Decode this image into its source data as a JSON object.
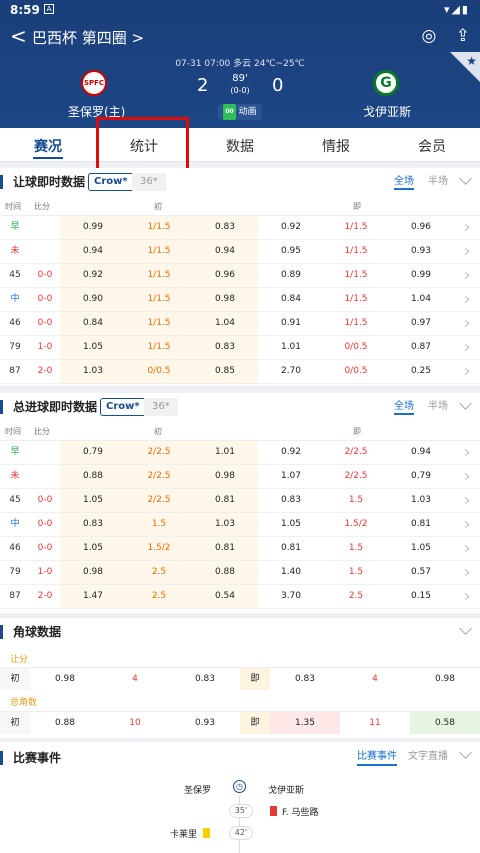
{
  "status": {
    "time": "8:59",
    "notif": "A",
    "icons": "▾◢▮"
  },
  "nav": {
    "back": "<",
    "league": "巴西杯 第四圈 >",
    "icons": [
      "◎",
      "⇪"
    ]
  },
  "match": {
    "info": "07-31 07:00  多云 24℃~25℃",
    "home": {
      "name": "圣保罗(主)",
      "score": "2",
      "logo_text": "SPFC"
    },
    "away": {
      "name": "戈伊亚斯",
      "score": "0",
      "logo_text": "G"
    },
    "minute": "89'",
    "half": "(0-0)",
    "anim_badge": "00",
    "anim_label": "动画"
  },
  "tabs": [
    "赛况",
    "统计",
    "数据",
    "情报",
    "会员"
  ],
  "handicap": {
    "title": "让球即时数据",
    "company": "Crow*",
    "company2": "36*",
    "scope_on": "全场",
    "scope_off": "半场",
    "cols": {
      "time": "时间",
      "score": "比分",
      "init": "初",
      "live": "即"
    },
    "rows": [
      {
        "t": "早",
        "s": "",
        "a": "0.99",
        "b": "1/1.5",
        "c": "0.83",
        "d": "0.92",
        "e": "1/1.5",
        "f": "0.96"
      },
      {
        "t": "未",
        "s": "",
        "a": "0.94",
        "b": "1/1.5",
        "c": "0.94",
        "d": "0.95",
        "e": "1/1.5",
        "f": "0.93"
      },
      {
        "t": "45",
        "s": "0-0",
        "a": "0.92",
        "b": "1/1.5",
        "c": "0.96",
        "d": "0.89",
        "e": "1/1.5",
        "f": "0.99"
      },
      {
        "t": "中",
        "s": "0-0",
        "a": "0.90",
        "b": "1/1.5",
        "c": "0.98",
        "d": "0.84",
        "e": "1/1.5",
        "f": "1.04"
      },
      {
        "t": "46",
        "s": "0-0",
        "a": "0.84",
        "b": "1/1.5",
        "c": "1.04",
        "d": "0.91",
        "e": "1/1.5",
        "f": "0.97"
      },
      {
        "t": "79",
        "s": "1-0",
        "a": "1.05",
        "b": "1/1.5",
        "c": "0.83",
        "d": "1.01",
        "e": "0/0.5",
        "f": "0.87"
      },
      {
        "t": "87",
        "s": "2-0",
        "a": "1.03",
        "b": "0/0.5",
        "c": "0.85",
        "d": "2.70",
        "e": "0/0.5",
        "f": "0.25"
      }
    ]
  },
  "totals": {
    "title": "总进球即时数据",
    "company": "Crow*",
    "company2": "36*",
    "scope_on": "全场",
    "scope_off": "半场",
    "cols": {
      "time": "时间",
      "score": "比分",
      "init": "初",
      "live": "即"
    },
    "rows": [
      {
        "t": "早",
        "s": "",
        "a": "0.79",
        "b": "2/2.5",
        "c": "1.01",
        "d": "0.92",
        "e": "2/2.5",
        "f": "0.94"
      },
      {
        "t": "未",
        "s": "",
        "a": "0.88",
        "b": "2/2.5",
        "c": "0.98",
        "d": "1.07",
        "e": "2/2.5",
        "f": "0.79"
      },
      {
        "t": "45",
        "s": "0-0",
        "a": "1.05",
        "b": "2/2.5",
        "c": "0.81",
        "d": "0.83",
        "e": "1.5",
        "f": "1.03"
      },
      {
        "t": "中",
        "s": "0-0",
        "a": "0.83",
        "b": "1.5",
        "c": "1.03",
        "d": "1.05",
        "e": "1.5/2",
        "f": "0.81"
      },
      {
        "t": "46",
        "s": "0-0",
        "a": "1.05",
        "b": "1.5/2",
        "c": "0.81",
        "d": "0.81",
        "e": "1.5",
        "f": "1.05"
      },
      {
        "t": "79",
        "s": "1-0",
        "a": "0.98",
        "b": "2.5",
        "c": "0.88",
        "d": "1.40",
        "e": "1.5",
        "f": "0.57"
      },
      {
        "t": "87",
        "s": "2-0",
        "a": "1.47",
        "b": "2.5",
        "c": "0.54",
        "d": "3.70",
        "e": "2.5",
        "f": "0.15"
      }
    ]
  },
  "corners": {
    "title": "角球数据",
    "handicap_label": "让分",
    "total_label": "总角数",
    "init": "初",
    "live": "即",
    "handicap_row": {
      "a": "0.98",
      "b": "4",
      "c": "0.83",
      "d": "0.83",
      "e": "4",
      "f": "0.98"
    },
    "total_row": {
      "a": "0.88",
      "b": "10",
      "c": "0.93",
      "d": "1.35",
      "e": "11",
      "f": "0.58"
    },
    "colors": {
      "down": "#fde7e7",
      "up": "#e8f5e3"
    }
  },
  "events": {
    "title": "比赛事件",
    "tab_on": "比赛事件",
    "tab_off": "文字直播",
    "home": "圣保罗",
    "away": "戈伊亚斯",
    "list": [
      {
        "min": "35'",
        "side": "away",
        "player": "F. 马些路",
        "card": "red"
      },
      {
        "min": "42'",
        "side": "home",
        "player": "卡莱里",
        "card": "yellow"
      }
    ]
  }
}
